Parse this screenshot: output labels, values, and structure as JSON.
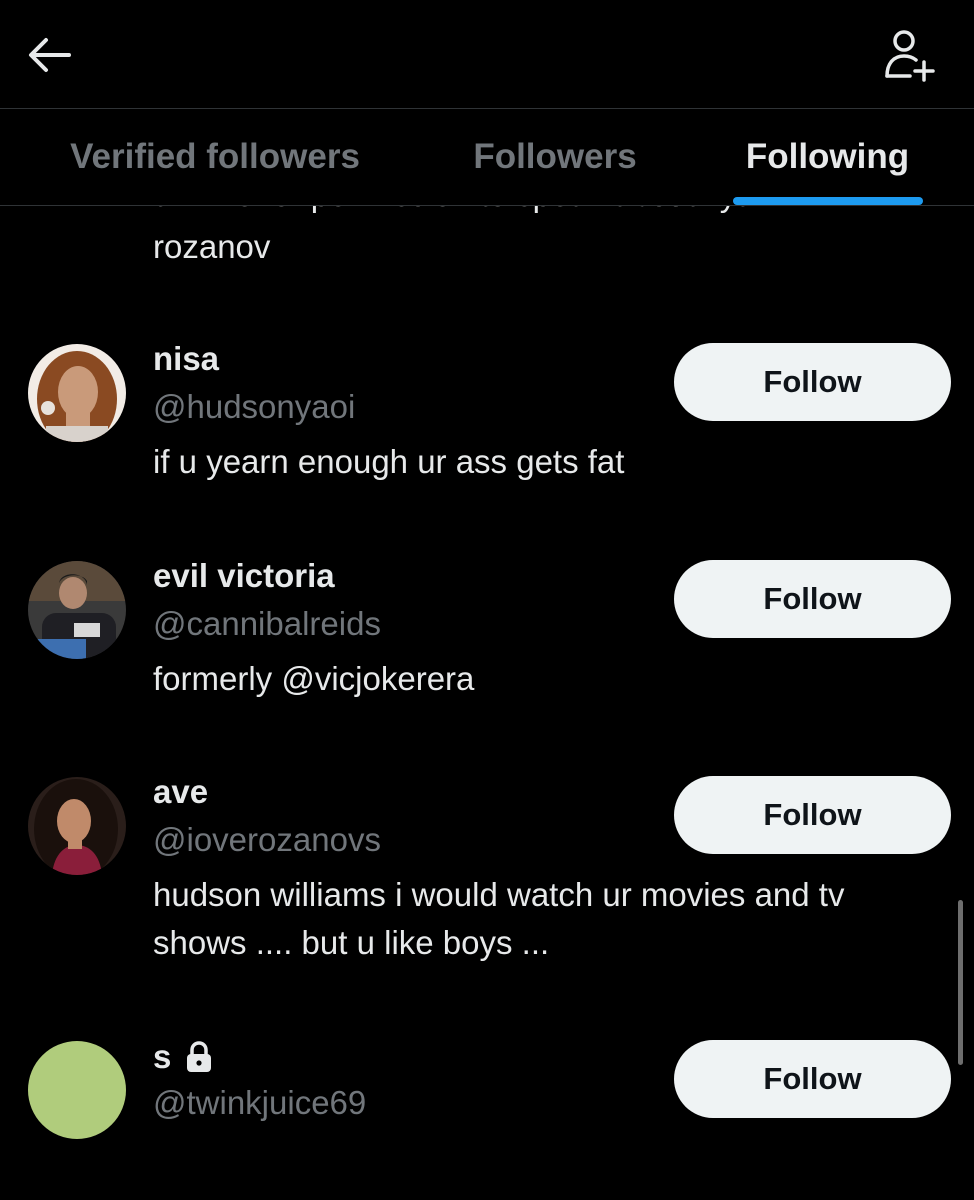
{
  "header": {
    "back_icon": "arrow-left-icon",
    "add_user_icon": "person-add-icon"
  },
  "tabs": [
    {
      "label": "Verified followers",
      "active": false
    },
    {
      "label": "Followers",
      "active": false
    },
    {
      "label": "Following",
      "active": true
    }
  ],
  "accent_color": "#1d9bf0",
  "clipped_bio": {
    "line1": "dm me for permission to speak about ilya",
    "line2": "rozanov"
  },
  "users": [
    {
      "name": "nisa",
      "handle": "@hudsonyaoi",
      "bio": "if u yearn enough ur ass gets fat",
      "button": "Follow",
      "locked": false
    },
    {
      "name": "evil victoria",
      "handle": "@cannibalreids",
      "bio": "formerly @vicjokerera",
      "button": "Follow",
      "locked": false
    },
    {
      "name": "ave",
      "handle": "@ioverozanovs",
      "bio": "hudson williams i would watch ur movies and tv shows .... but u like boys ...",
      "button": "Follow",
      "locked": false
    },
    {
      "name": "s",
      "handle": "@twinkjuice69",
      "bio": "",
      "button": "Follow",
      "locked": true,
      "avatar_color": "#b0cc7c"
    }
  ]
}
